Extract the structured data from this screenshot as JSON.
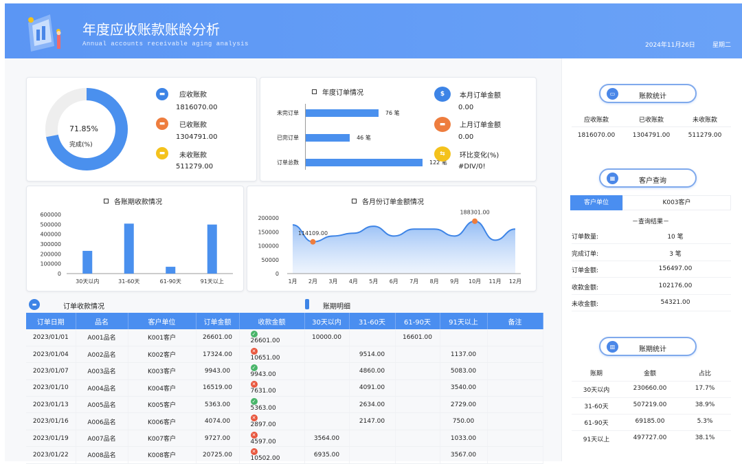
{
  "header": {
    "title": "年度应收账款账龄分析",
    "subtitle": "Annual accounts receivable aging analysis",
    "date": "2024年11月26日",
    "weekday": "星期二"
  },
  "donut": {
    "percent_text": "71.85%",
    "label": "完成(%)",
    "fraction": 0.7185,
    "color": "#4a90ee",
    "track": "#eeeeee"
  },
  "receivables": [
    {
      "label": "应收账款",
      "value": "1816070.00",
      "icon": "card-icon",
      "color": "#3d84e6"
    },
    {
      "label": "已收账款",
      "value": "1304791.00",
      "icon": "card-icon",
      "color": "#ee7d3e"
    },
    {
      "label": "未收账款",
      "value": "511279.00",
      "icon": "card-icon",
      "color": "#f4c21c"
    }
  ],
  "orders": {
    "title": "年度订单情况",
    "bars": [
      {
        "label": "未完订单",
        "value": 76,
        "text": "76 笔"
      },
      {
        "label": "已完订单",
        "value": 46,
        "text": "46 笔"
      },
      {
        "label": "订单总数",
        "value": 122,
        "text": "122 笔"
      }
    ],
    "max": 122
  },
  "month_amount": [
    {
      "label": "本月订单金额",
      "value": "0.00",
      "icon": "dollar-icon",
      "glyph": "$",
      "color": "#3d84e6"
    },
    {
      "label": "上月订单金额",
      "value": "0.00",
      "icon": "card-icon",
      "glyph": "",
      "color": "#ee7d3e"
    },
    {
      "label": "环比变化(%)",
      "value": "#DIV/0!",
      "icon": "share-icon",
      "glyph": "",
      "color": "#f4c21c"
    }
  ],
  "chart_data": [
    {
      "type": "bar",
      "title": "各账期收款情况",
      "categories": [
        "30天以内",
        "31-60天",
        "61-90天",
        "91天以上"
      ],
      "values": [
        230660,
        507219,
        69185,
        497727
      ],
      "ylim": [
        0,
        600000
      ],
      "yticks": [
        "600000",
        "500000",
        "400000",
        "300000",
        "200000",
        "100000",
        "0"
      ],
      "color": "#4a90ee"
    },
    {
      "type": "area",
      "title": "各月份订单金额情况",
      "categories": [
        "1月",
        "2月",
        "3月",
        "4月",
        "5月",
        "6月",
        "7月",
        "8月",
        "9月",
        "10月",
        "11月",
        "12月"
      ],
      "values": [
        175000,
        114109,
        135000,
        145000,
        170000,
        135000,
        160000,
        160000,
        135000,
        188301,
        120000,
        160000
      ],
      "ylim": [
        0,
        200000
      ],
      "yticks": [
        "200000",
        "150000",
        "100000",
        "50000",
        "0"
      ],
      "annotations": [
        {
          "month": "2月",
          "text": "114109.00"
        },
        {
          "month": "10月",
          "text": "188301.00"
        }
      ],
      "line_color": "#3d84e6",
      "marker_color": "#ee7d3e"
    }
  ],
  "section": {
    "orders_title": "订单收款情况",
    "aging_title": "账期明细"
  },
  "table": {
    "headers": [
      "订单日期",
      "品名",
      "客户单位",
      "订单金额",
      "收款金额",
      "30天以内",
      "31-60天",
      "61-90天",
      "91天以上",
      "备注"
    ],
    "rows": [
      {
        "date": "2023/01/01",
        "item": "A001品名",
        "client": "K001客户",
        "amount": "26601.00",
        "ok": true,
        "paid": "26601.00",
        "a30": "10000.00",
        "a60": "",
        "a90": "16601.00",
        "a91": "",
        "note": ""
      },
      {
        "date": "2023/01/04",
        "item": "A002品名",
        "client": "K002客户",
        "amount": "17324.00",
        "ok": false,
        "paid": "10651.00",
        "a30": "",
        "a60": "9514.00",
        "a90": "",
        "a91": "1137.00",
        "note": ""
      },
      {
        "date": "2023/01/07",
        "item": "A003品名",
        "client": "K003客户",
        "amount": "9943.00",
        "ok": true,
        "paid": "9943.00",
        "a30": "",
        "a60": "4860.00",
        "a90": "",
        "a91": "5083.00",
        "note": ""
      },
      {
        "date": "2023/01/10",
        "item": "A004品名",
        "client": "K004客户",
        "amount": "16519.00",
        "ok": false,
        "paid": "7631.00",
        "a30": "",
        "a60": "4091.00",
        "a90": "",
        "a91": "3540.00",
        "note": ""
      },
      {
        "date": "2023/01/13",
        "item": "A005品名",
        "client": "K005客户",
        "amount": "5363.00",
        "ok": true,
        "paid": "5363.00",
        "a30": "",
        "a60": "2634.00",
        "a90": "",
        "a91": "2729.00",
        "note": ""
      },
      {
        "date": "2023/01/16",
        "item": "A006品名",
        "client": "K006客户",
        "amount": "4074.00",
        "ok": false,
        "paid": "2897.00",
        "a30": "",
        "a60": "2147.00",
        "a90": "",
        "a91": "750.00",
        "note": ""
      },
      {
        "date": "2023/01/19",
        "item": "A007品名",
        "client": "K007客户",
        "amount": "9727.00",
        "ok": false,
        "paid": "4597.00",
        "a30": "3564.00",
        "a60": "",
        "a90": "",
        "a91": "1033.00",
        "note": ""
      },
      {
        "date": "2023/01/22",
        "item": "A008品名",
        "client": "K008客户",
        "amount": "20725.00",
        "ok": false,
        "paid": "10502.00",
        "a30": "6935.00",
        "a60": "",
        "a90": "",
        "a91": "3567.00",
        "note": ""
      }
    ]
  },
  "right": {
    "stats_title": "账款统计",
    "stats_headers": [
      "应收账款",
      "已收账款",
      "未收账款"
    ],
    "stats_values": [
      "1816070.00",
      "1304791.00",
      "511279.00"
    ],
    "query_title": "客户查询",
    "query_label": "客户单位",
    "query_value": "K003客户",
    "query_result": "－查询结果－",
    "query_rows": [
      {
        "label": "订单数量:",
        "value": "10 笔"
      },
      {
        "label": "完成订单:",
        "value": "3 笔"
      },
      {
        "label": "订单金额:",
        "value": "156497.00"
      },
      {
        "label": "收款金额:",
        "value": "102176.00"
      },
      {
        "label": "未收金额:",
        "value": "54321.00"
      }
    ],
    "aging_title": "账期统计",
    "aging_headers": [
      "账期",
      "金额",
      "占比"
    ],
    "aging_rows": [
      {
        "period": "30天以内",
        "amount": "230660.00",
        "ratio": "17.7%"
      },
      {
        "period": "31-60天",
        "amount": "507219.00",
        "ratio": "38.9%"
      },
      {
        "period": "61-90天",
        "amount": "69185.00",
        "ratio": "5.3%"
      },
      {
        "period": "91天以上",
        "amount": "497727.00",
        "ratio": "38.1%"
      }
    ]
  }
}
